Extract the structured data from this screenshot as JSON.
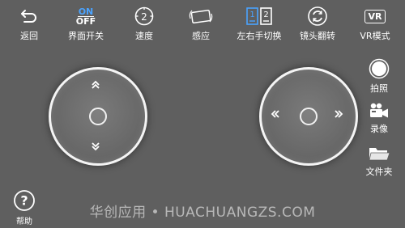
{
  "toolbar": {
    "items": [
      {
        "label": "返回",
        "icon": "back-arrow-icon"
      },
      {
        "label": "界面开关",
        "icon": "on-off-toggle-icon",
        "on_text": "ON",
        "off_text": "OFF"
      },
      {
        "label": "速度",
        "icon": "speed-gauge-icon",
        "value": "2"
      },
      {
        "label": "感应",
        "icon": "phone-rotate-icon"
      },
      {
        "label": "左右手切换",
        "icon": "hand-switch-icon",
        "left_num": "1",
        "right_num": "2"
      },
      {
        "label": "镜头翻转",
        "icon": "camera-flip-icon"
      },
      {
        "label": "VR模式",
        "icon": "vr-icon",
        "badge": "VR"
      }
    ]
  },
  "side": {
    "photo_label": "拍照",
    "video_label": "录像",
    "folder_label": "文件夹"
  },
  "help": {
    "label": "帮助",
    "symbol": "?"
  },
  "watermark": "华创应用 • HUACHUANGZS.COM",
  "colors": {
    "background": "#5f5f5f",
    "accent_blue": "#4aa3ff",
    "foreground": "#ffffff"
  }
}
